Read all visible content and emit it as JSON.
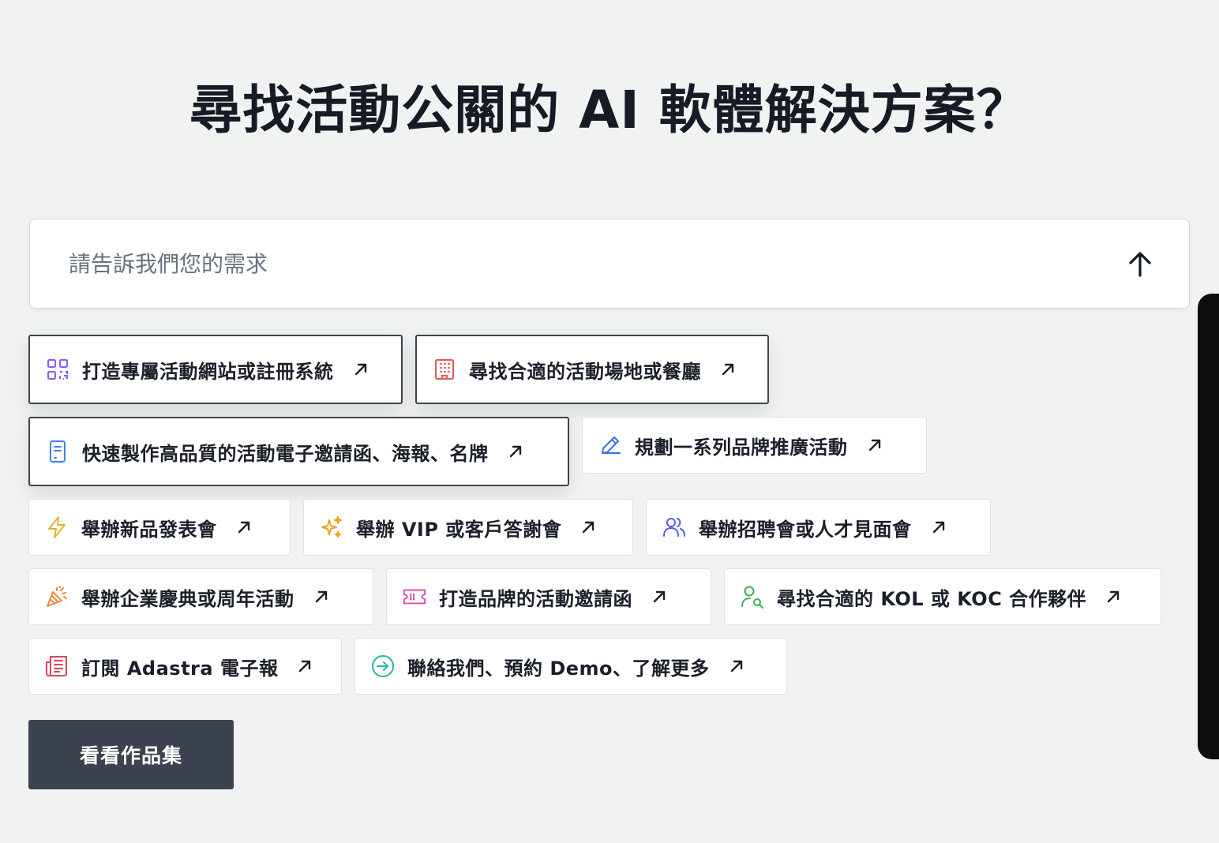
{
  "heading": "尋找活動公關的 AI 軟體解決方案？",
  "ask": {
    "placeholder": "請告訴我們您的需求",
    "submit_icon": "arrow-up-icon"
  },
  "chips": [
    {
      "label": "打造專屬活動網站或註冊系統",
      "icon": "qr-code-icon",
      "color": "#8b5cf6"
    },
    {
      "label": "尋找合適的活動場地或餐廳",
      "icon": "building-icon",
      "color": "#e05a4f"
    },
    {
      "label": "快速製作高品質的活動電子邀請函、海報、名牌",
      "icon": "document-icon",
      "color": "#3b82f6"
    },
    {
      "label": "規劃一系列品牌推廣活動",
      "icon": "pencil-icon",
      "color": "#3b6fe0"
    },
    {
      "label": "舉辦新品發表會",
      "icon": "lightning-icon",
      "color": "#e0b42a"
    },
    {
      "label": "舉辦 VIP 或客戶答謝會",
      "icon": "sparkles-icon",
      "color": "#f0a020"
    },
    {
      "label": "舉辦招聘會或人才見面會",
      "icon": "users-icon",
      "color": "#5b5fe0"
    },
    {
      "label": "舉辦企業慶典或周年活動",
      "icon": "party-popper-icon",
      "color": "#f08a3a"
    },
    {
      "label": "打造品牌的活動邀請函",
      "icon": "ticket-icon",
      "color": "#e04aa0"
    },
    {
      "label": "尋找合適的 KOL 或 KOC 合作夥伴",
      "icon": "user-search-icon",
      "color": "#3fae5a"
    },
    {
      "label": "訂閱 Adastra 電子報",
      "icon": "newspaper-icon",
      "color": "#e0435a"
    },
    {
      "label": "聯絡我們、預約 Demo、了解更多",
      "icon": "arrow-circle-right-icon",
      "color": "#2bb5a0"
    }
  ],
  "chip_arrow_icon": "arrow-up-right-icon",
  "portfolio_button": "看看作品集"
}
